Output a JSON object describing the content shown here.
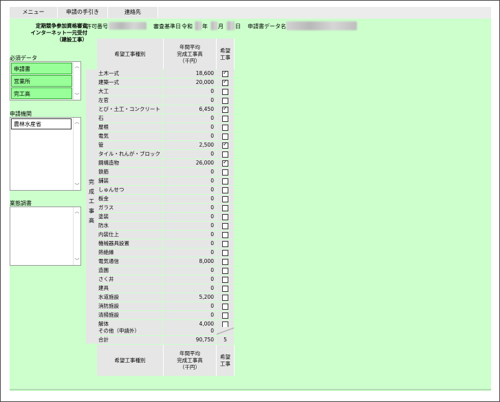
{
  "menu": {
    "items": [
      "メニュー",
      "申請の手引き",
      "連絡先"
    ]
  },
  "header": {
    "title_lines": [
      "定期競争参加資格審査",
      "インターネット一元受付",
      "（建設工事）"
    ],
    "permit_label": "許可番号",
    "date_label": "審査基準日",
    "era": "令和",
    "year_unit": "年",
    "month_unit": "月",
    "day_unit": "日",
    "data_name_label": "申請書データ名"
  },
  "sidebar": {
    "required_label": "必須データ",
    "required_items": [
      "申請書",
      "営業所",
      "完工高"
    ],
    "agency_label": "申請機関",
    "agencies": [
      "農林水産省"
    ],
    "survey_label": "業態調書"
  },
  "table": {
    "side_label": [
      "完",
      "成",
      "工",
      "事",
      "高"
    ],
    "header": {
      "type": "希望工事種別",
      "amount_lines": [
        "年間平均",
        "完成工事高",
        "（千円）"
      ],
      "wish_lines": [
        "希望",
        "工事"
      ]
    },
    "rows": [
      {
        "name": "土木一式",
        "value": "18,600",
        "checked": true
      },
      {
        "name": "建築一式",
        "value": "20,000",
        "checked": true
      },
      {
        "name": "大工",
        "value": "0",
        "checked": false
      },
      {
        "name": "左官",
        "value": "0",
        "checked": false
      },
      {
        "name": "とび・土工・コンクリート",
        "value": "6,450",
        "checked": true
      },
      {
        "name": "石",
        "value": "0",
        "checked": false
      },
      {
        "name": "屋根",
        "value": "0",
        "checked": false
      },
      {
        "name": "電気",
        "value": "0",
        "checked": false
      },
      {
        "name": "管",
        "value": "2,500",
        "checked": true
      },
      {
        "name": "タイル・れんが・ブロック",
        "value": "0",
        "checked": false
      },
      {
        "name": "鋼構造物",
        "value": "26,000",
        "checked": true
      },
      {
        "name": "鉄筋",
        "value": "0",
        "checked": false
      },
      {
        "name": "舗装",
        "value": "0",
        "checked": false
      },
      {
        "name": "しゅんせつ",
        "value": "0",
        "checked": false
      },
      {
        "name": "板金",
        "value": "0",
        "checked": false
      },
      {
        "name": "ガラス",
        "value": "0",
        "checked": false
      },
      {
        "name": "塗装",
        "value": "0",
        "checked": false
      },
      {
        "name": "防水",
        "value": "0",
        "checked": false
      },
      {
        "name": "内装仕上",
        "value": "0",
        "checked": false
      },
      {
        "name": "機械器具設置",
        "value": "0",
        "checked": false
      },
      {
        "name": "熱絶縁",
        "value": "0",
        "checked": false
      },
      {
        "name": "電気通信",
        "value": "8,000",
        "checked": false
      },
      {
        "name": "造園",
        "value": "0",
        "checked": false
      },
      {
        "name": "さく井",
        "value": "0",
        "checked": false
      },
      {
        "name": "建具",
        "value": "0",
        "checked": false
      },
      {
        "name": "水道施設",
        "value": "5,200",
        "checked": false
      },
      {
        "name": "消防施設",
        "value": "0",
        "checked": false
      },
      {
        "name": "清掃施設",
        "value": "0",
        "checked": false
      },
      {
        "name": "解体",
        "value": "4,000",
        "checked": false
      }
    ],
    "other": {
      "name": "その他（申請外）",
      "value": "0"
    },
    "total": {
      "name": "合計",
      "value": "90,750",
      "count": "5"
    }
  },
  "colors": {
    "background": "#ccffcc",
    "required_item": "#99ff99",
    "header_gray": "#e6e6e6"
  }
}
